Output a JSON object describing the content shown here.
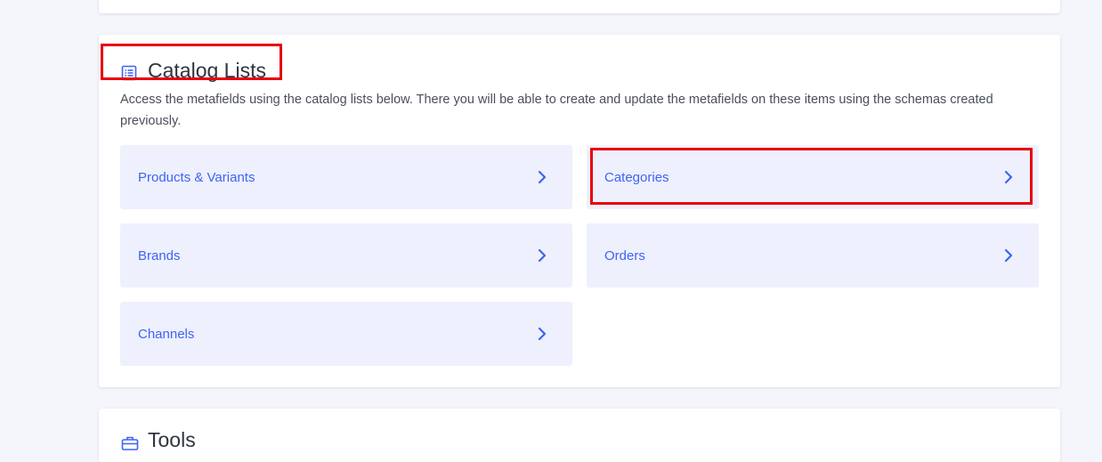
{
  "catalog": {
    "title": "Catalog Lists",
    "description": "Access the metafields using the catalog lists below. There you will be able to create and update the metafields on these items using the schemas created previously.",
    "items": [
      {
        "label": "Products & Variants"
      },
      {
        "label": "Categories"
      },
      {
        "label": "Brands"
      },
      {
        "label": "Orders"
      },
      {
        "label": "Channels"
      }
    ]
  },
  "tools": {
    "title": "Tools"
  },
  "colors": {
    "accent": "#3c64f4",
    "tile_bg": "#eff0fd",
    "highlight": "#e8000b",
    "page_bg": "#f5f6fb"
  },
  "icons": {
    "catalog": "list-icon",
    "tile_arrow": "chevron-right-icon",
    "tools": "toolbox-icon"
  }
}
